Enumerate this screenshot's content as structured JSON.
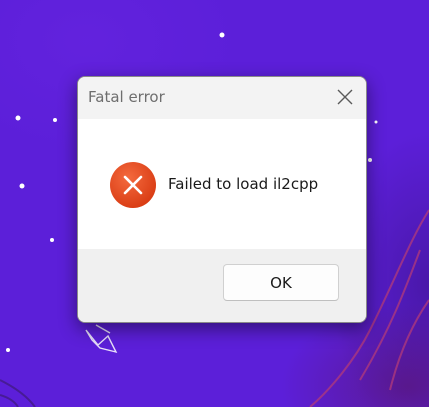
{
  "dialog": {
    "title": "Fatal error",
    "message": "Failed to load il2cpp",
    "ok_label": "OK",
    "close_icon": "close-icon",
    "status_icon": "error-icon"
  },
  "colors": {
    "wallpaper": "#5c1fd9",
    "error_icon_red": "#e8491d",
    "title_text": "#6e6e6e",
    "body_background": "#ffffff",
    "footer_background": "#f0f0f0"
  }
}
